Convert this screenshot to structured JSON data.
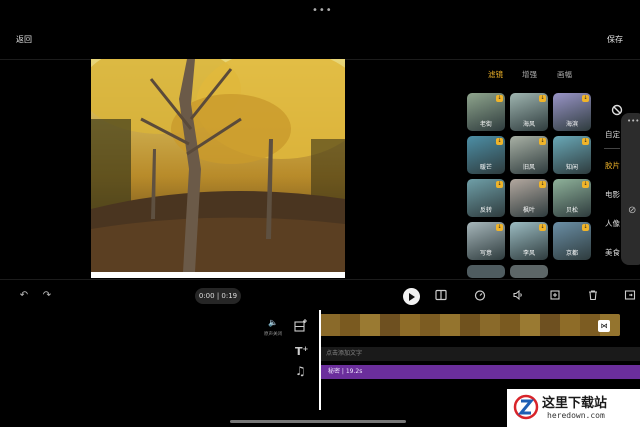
{
  "topbar": {
    "back_label": "返回",
    "save_label": "保存"
  },
  "filter_panel": {
    "tabs": [
      {
        "label": "滤镜",
        "active": true
      },
      {
        "label": "增强",
        "active": false
      },
      {
        "label": "画幅",
        "active": false
      }
    ],
    "filters": [
      {
        "label": "老街",
        "color": "#8fa58d"
      },
      {
        "label": "海风",
        "color": "#9fb5b0"
      },
      {
        "label": "海滨",
        "color": "#9a95c8"
      },
      {
        "label": "暖芒",
        "color": "#4d8fa6"
      },
      {
        "label": "旧风",
        "color": "#a9b1a5"
      },
      {
        "label": "知闲",
        "color": "#6aa9b8"
      },
      {
        "label": "反转",
        "color": "#6f9fa8"
      },
      {
        "label": "枫叶",
        "color": "#b3a89f"
      },
      {
        "label": "贝松",
        "color": "#8fb29a"
      },
      {
        "label": "写意",
        "color": "#a7b7bb"
      },
      {
        "label": "李风",
        "color": "#9cbcc2"
      },
      {
        "label": "京都",
        "color": "#6b8fa6"
      }
    ],
    "categories": [
      {
        "label": "自定",
        "active": false
      },
      {
        "label": "胶片",
        "active": true
      },
      {
        "label": "电影",
        "active": false
      },
      {
        "label": "人像",
        "active": false
      },
      {
        "label": "美食",
        "active": false
      }
    ]
  },
  "editor_toolbar": {
    "time": "0:00 | 0:19"
  },
  "timeline": {
    "mute_label": "原声关闭",
    "text_track_placeholder": "点击添加文字",
    "audio_track_label": "秘密 | 19.2s"
  },
  "watermark": {
    "title": "这里下载站",
    "url": "heredown.com"
  },
  "colors": {
    "accent": "#f0b429",
    "audio_track": "#6b2e9c"
  }
}
